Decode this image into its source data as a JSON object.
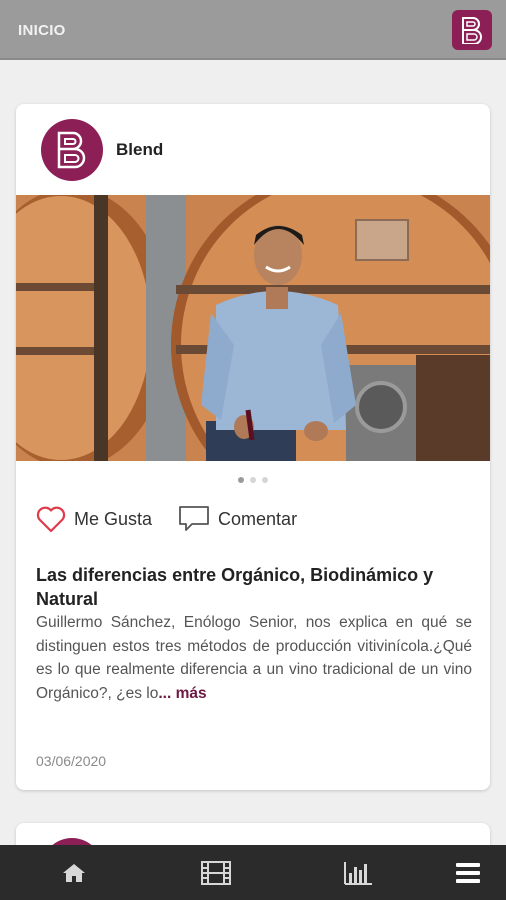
{
  "header": {
    "title": "INICIO",
    "logo_icon": "blend-logo-icon"
  },
  "post": {
    "author": "Blend",
    "image_alt": "winemaker-photo",
    "carousel": {
      "count": 3,
      "active": 0
    },
    "actions": {
      "like_label": "Me Gusta",
      "comment_label": "Comentar"
    },
    "title": "Las diferencias entre Orgánico, Biodinámico y Natural",
    "excerpt": "Guillermo Sánchez, Enólogo Senior, nos explica en qué se distinguen estos tres métodos de producción vitivinícola.¿Qué es lo que realmente diferencia a un vino tradicional de un vino Orgánico?, ¿es lo",
    "more_label": "... más",
    "date": "03/06/2020"
  },
  "bottom_nav": {
    "items": [
      "home-icon",
      "film-icon",
      "bar-chart-icon",
      "menu-icon"
    ]
  },
  "colors": {
    "brand": "#8c1f56",
    "header_bg": "#9b9b9b",
    "nav_bg": "#2b2b2b",
    "like": "#e03a4a"
  }
}
